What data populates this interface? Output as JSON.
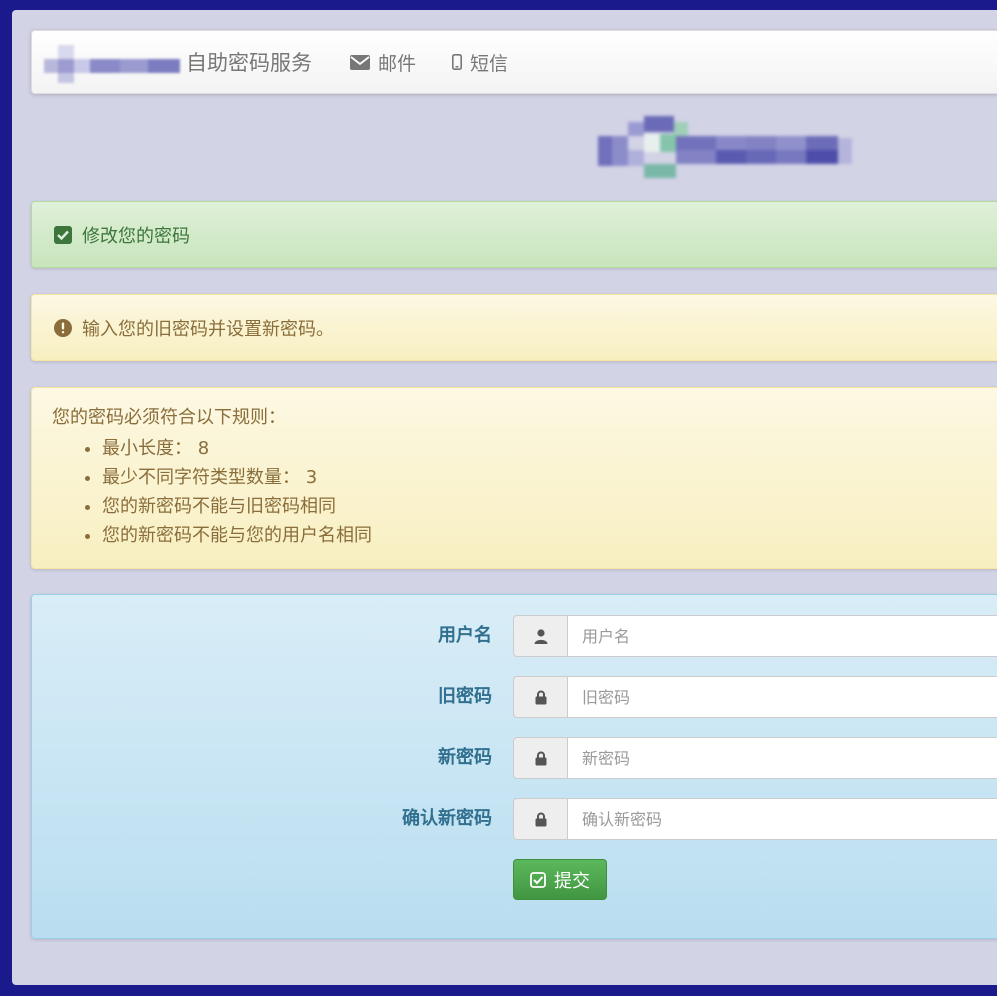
{
  "header": {
    "brand": "自助密码服务",
    "nav": [
      {
        "label": "邮件",
        "icon": "envelope-icon"
      },
      {
        "label": "短信",
        "icon": "mobile-icon"
      }
    ]
  },
  "alerts": {
    "success": {
      "text": "修改您的密码",
      "icon": "check-square-icon"
    },
    "warning": {
      "text": "输入您的旧密码并设置新密码。",
      "icon": "exclamation-circle-icon"
    }
  },
  "rules": {
    "title": "您的密码必须符合以下规则：",
    "items": [
      "最小长度： 8",
      "最少不同字符类型数量： 3",
      "您的新密码不能与旧密码相同",
      "您的新密码不能与您的用户名相同"
    ]
  },
  "form": {
    "fields": [
      {
        "label": "用户名",
        "placeholder": "用户名",
        "icon": "user-icon"
      },
      {
        "label": "旧密码",
        "placeholder": "旧密码",
        "icon": "lock-icon"
      },
      {
        "label": "新密码",
        "placeholder": "新密码",
        "icon": "lock-icon"
      },
      {
        "label": "确认新密码",
        "placeholder": "确认新密码",
        "icon": "lock-icon"
      }
    ],
    "submit_label": "提交"
  },
  "colors": {
    "page_bg": "#d3d3e6",
    "frame": "#1a1a8c",
    "success_text": "#3c763d",
    "warning_text": "#8a6d3b",
    "info_label": "#31708f",
    "submit_bg": "#4cae4c"
  }
}
